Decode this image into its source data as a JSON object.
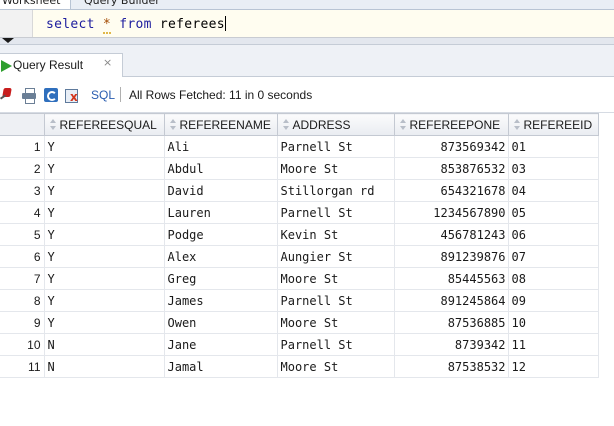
{
  "worksheet_tabs": [
    "Worksheet",
    "Query Builder"
  ],
  "editor": {
    "kw_select": "select",
    "star": "*",
    "kw_from": "from",
    "table": "referees"
  },
  "result_tab": {
    "label": "Query Result",
    "close": "×"
  },
  "toolbar": {
    "sql_label": "SQL",
    "separator": "|",
    "status": "All Rows Fetched: 11 in 0 seconds"
  },
  "grid": {
    "columns": [
      "REFEREESQUAL",
      "REFEREENAME",
      "ADDRESS",
      "REFEREEPONE",
      "REFEREEID"
    ],
    "rows": [
      {
        "n": "1",
        "qual": "Y",
        "name": "Ali",
        "address": "Parnell St",
        "phone": "873569342",
        "id": "01"
      },
      {
        "n": "2",
        "qual": "Y",
        "name": "Abdul",
        "address": "Moore St",
        "phone": "853876532",
        "id": "03"
      },
      {
        "n": "3",
        "qual": "Y",
        "name": "David",
        "address": "Stillorgan rd",
        "phone": "654321678",
        "id": "04"
      },
      {
        "n": "4",
        "qual": "Y",
        "name": "Lauren",
        "address": "Parnell St",
        "phone": "1234567890",
        "id": "05"
      },
      {
        "n": "5",
        "qual": "Y",
        "name": "Podge",
        "address": "Kevin  St",
        "phone": "456781243",
        "id": "06"
      },
      {
        "n": "6",
        "qual": "Y",
        "name": "Alex",
        "address": "Aungier St",
        "phone": "891239876",
        "id": "07"
      },
      {
        "n": "7",
        "qual": "Y",
        "name": "Greg",
        "address": "Moore St",
        "phone": "85445563",
        "id": "08"
      },
      {
        "n": "8",
        "qual": "Y",
        "name": "James",
        "address": "Parnell St",
        "phone": "891245864",
        "id": "09"
      },
      {
        "n": "9",
        "qual": "Y",
        "name": "Owen",
        "address": "Moore St",
        "phone": "87536885",
        "id": "10"
      },
      {
        "n": "10",
        "qual": "N",
        "name": "Jane",
        "address": "Parnell St",
        "phone": "8739342",
        "id": "11"
      },
      {
        "n": "11",
        "qual": "N",
        "name": "Jamal",
        "address": "Moore St",
        "phone": "87538532",
        "id": "12"
      }
    ]
  }
}
